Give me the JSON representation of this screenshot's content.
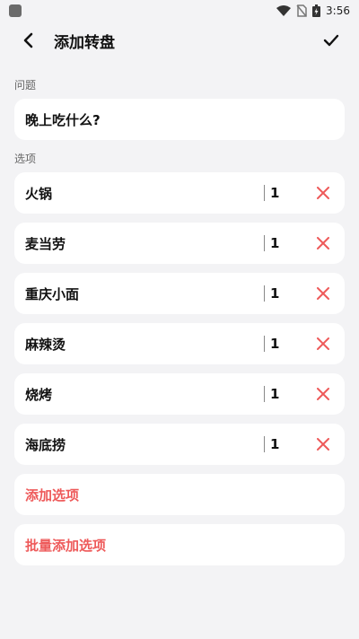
{
  "status_bar": {
    "time": "3:56"
  },
  "app_bar": {
    "title": "添加转盘"
  },
  "question": {
    "label": "问题",
    "value": "晚上吃什么?"
  },
  "options": {
    "label": "选项",
    "items": [
      {
        "name": "火锅",
        "weight": "1"
      },
      {
        "name": "麦当劳",
        "weight": "1"
      },
      {
        "name": "重庆小面",
        "weight": "1"
      },
      {
        "name": "麻辣烫",
        "weight": "1"
      },
      {
        "name": "烧烤",
        "weight": "1"
      },
      {
        "name": "海底捞",
        "weight": "1"
      }
    ]
  },
  "actions": {
    "add_option": "添加选项",
    "batch_add_option": "批量添加选项"
  },
  "colors": {
    "accent": "#ee5a5a",
    "background": "#f3f3f5",
    "card": "#ffffff"
  },
  "icons": {
    "back": "arrow-left-icon",
    "confirm": "check-icon",
    "delete": "close-icon"
  }
}
